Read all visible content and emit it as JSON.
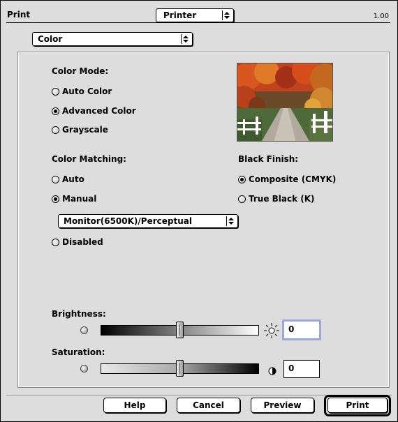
{
  "header": {
    "title": "Print",
    "printer_popup": "Printer",
    "version": "1.00"
  },
  "section_popup": {
    "value": "Color"
  },
  "color_mode": {
    "label": "Color Mode:",
    "options": [
      {
        "label": "Auto Color",
        "selected": false
      },
      {
        "label": "Advanced Color",
        "selected": true
      },
      {
        "label": "Grayscale",
        "selected": false
      }
    ]
  },
  "color_matching": {
    "label": "Color Matching:",
    "options": [
      {
        "label": "Auto",
        "selected": false
      },
      {
        "label": "Manual",
        "selected": true
      },
      {
        "label": "Disabled",
        "selected": false
      }
    ],
    "profile_popup": "Monitor(6500K)/Perceptual"
  },
  "black_finish": {
    "label": "Black Finish:",
    "options": [
      {
        "label": "Composite (CMYK)",
        "selected": true
      },
      {
        "label": "True Black (K)",
        "selected": false
      }
    ]
  },
  "brightness": {
    "label": "Brightness:",
    "value": "0",
    "level": 0.5,
    "icon": "sun-icon"
  },
  "saturation": {
    "label": "Saturation:",
    "value": "0",
    "level": 0.5,
    "icon": "half-circle-icon"
  },
  "buttons": {
    "help": "Help",
    "cancel": "Cancel",
    "preview": "Preview",
    "print": "Print"
  }
}
